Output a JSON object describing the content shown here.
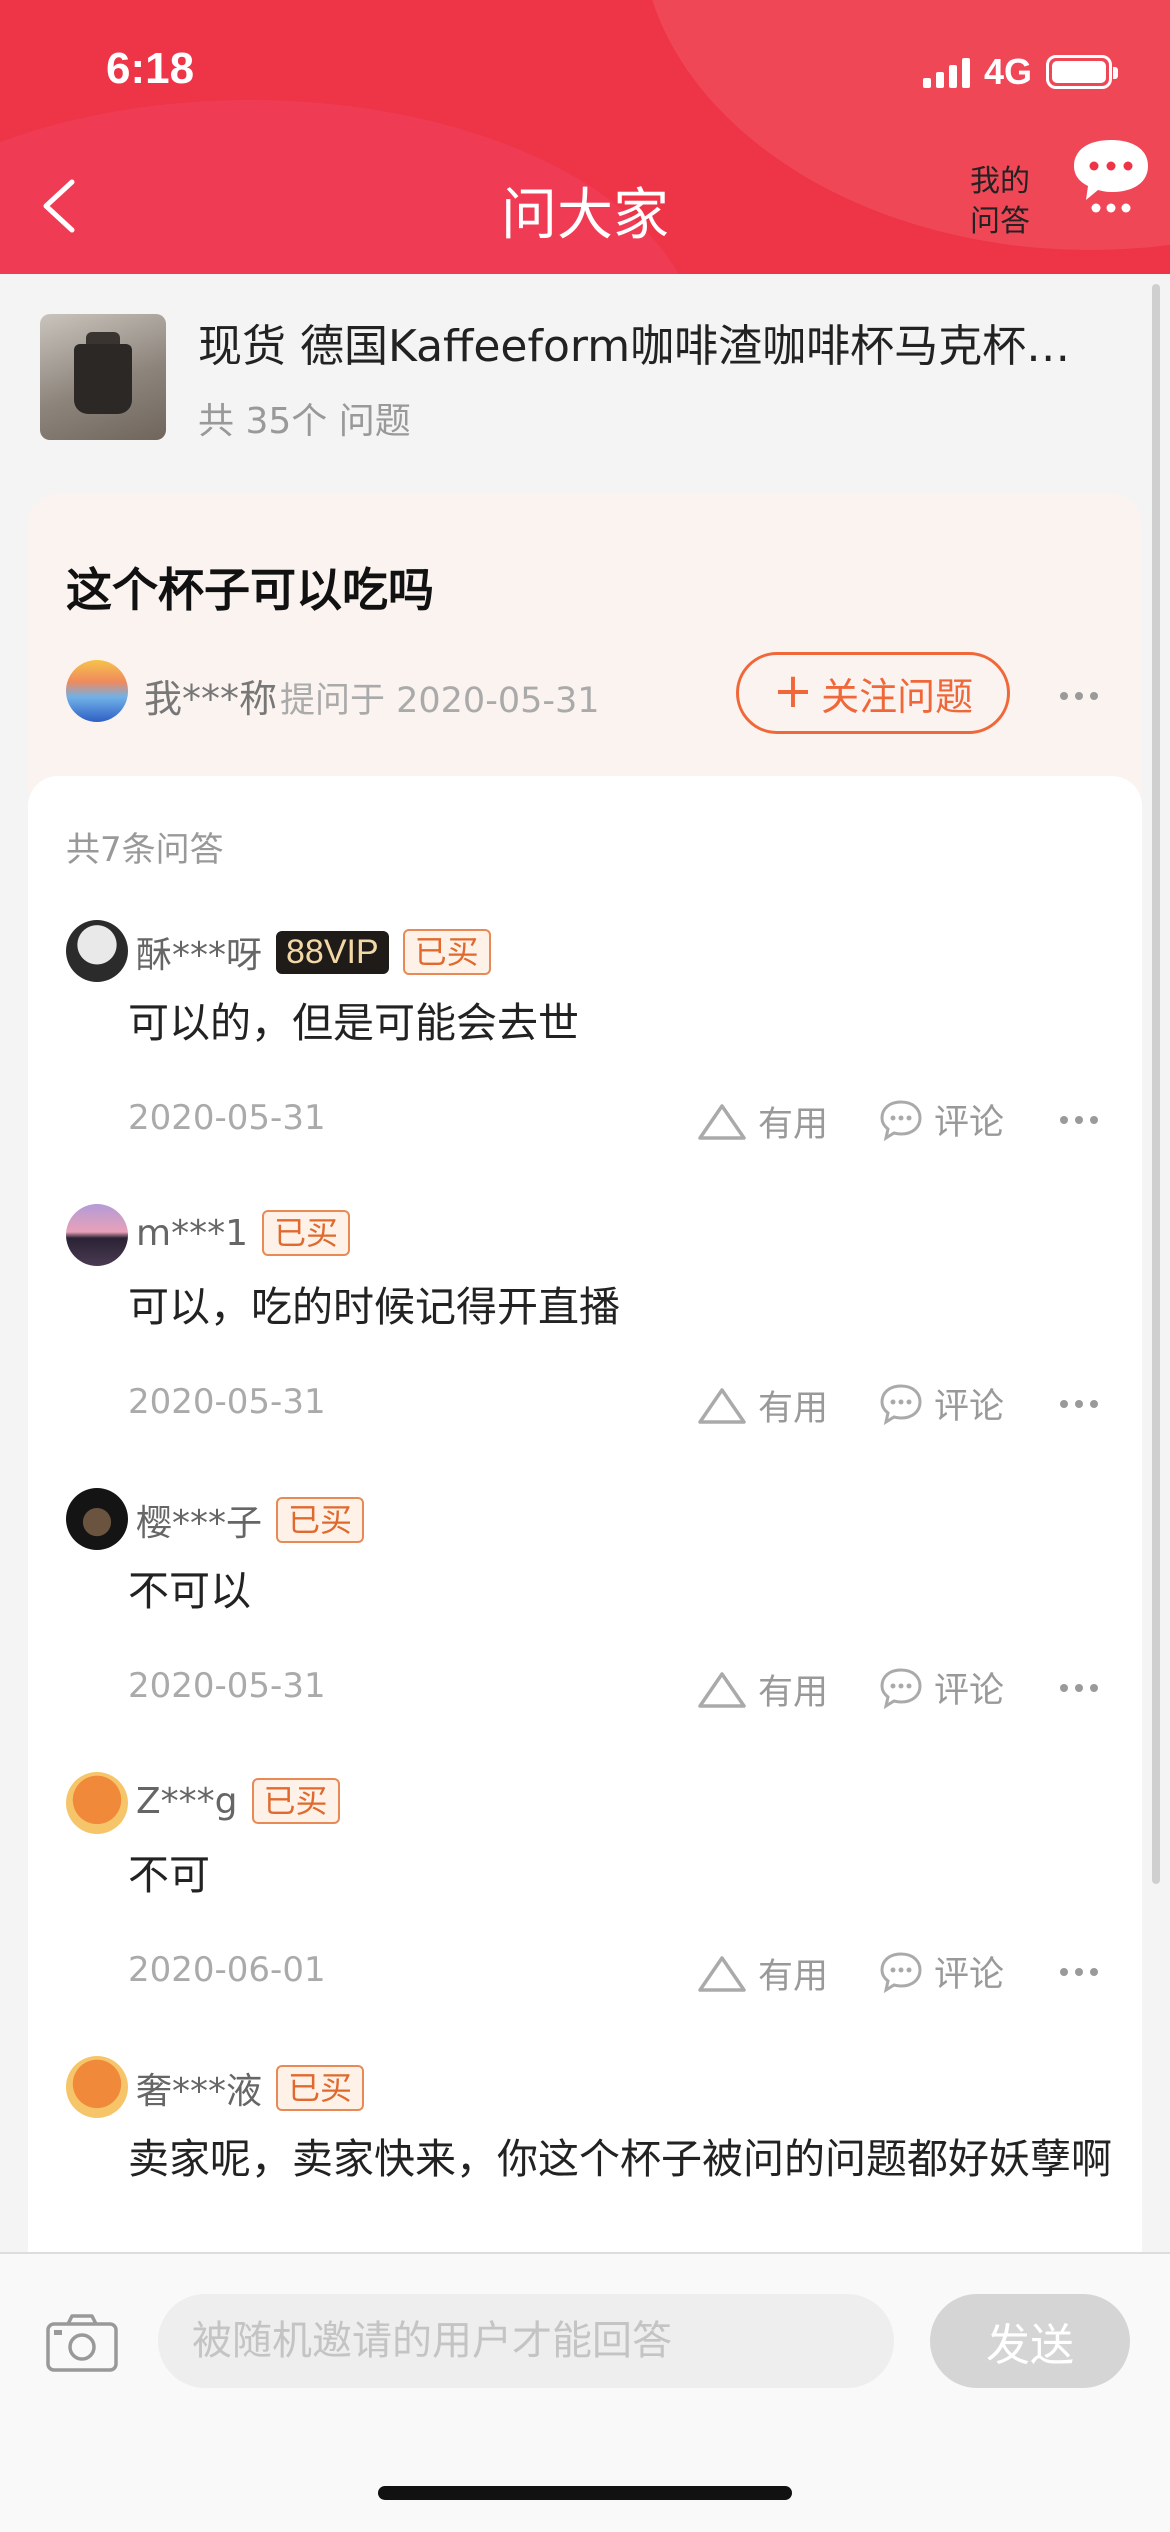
{
  "status_bar": {
    "time": "6:18",
    "network": "4G"
  },
  "header": {
    "title": "问大家",
    "my_qa_line1": "我的",
    "my_qa_line2": "问答"
  },
  "product": {
    "title": "现货 德国Kaffeeform咖啡渣咖啡杯马克杯…",
    "question_count": "共 35个 问题"
  },
  "question": {
    "text": "这个杯子可以吃吗",
    "asker": "我***称",
    "asked_at": "提问于 2020-05-31",
    "follow_label": "关注问题",
    "follow_icon": "+"
  },
  "answers_section": {
    "count_label": "共7条问答",
    "useful_label": "有用",
    "comment_label": "评论",
    "items": [
      {
        "user": "酥***呀",
        "vip": "88VIP",
        "badge": "已买",
        "text": "可以的，但是可能会去世",
        "date": "2020-05-31"
      },
      {
        "user": "m***1",
        "badge": "已买",
        "text": "可以，吃的时候记得开直播",
        "date": "2020-05-31"
      },
      {
        "user": "樱***子",
        "badge": "已买",
        "text": "不可以",
        "date": "2020-05-31"
      },
      {
        "user": "Z***g",
        "badge": "已买",
        "text": "不可",
        "date": "2020-06-01"
      },
      {
        "user": "奢***液",
        "badge": "已买",
        "text": "卖家呢，卖家快来，你这个杯子被问的问题都好妖孽啊"
      }
    ]
  },
  "bottom_bar": {
    "input_placeholder": "被随机邀请的用户才能回答",
    "send_label": "发送"
  },
  "colors": {
    "brand_red": "#ee3447",
    "accent_orange": "#f0683a"
  }
}
